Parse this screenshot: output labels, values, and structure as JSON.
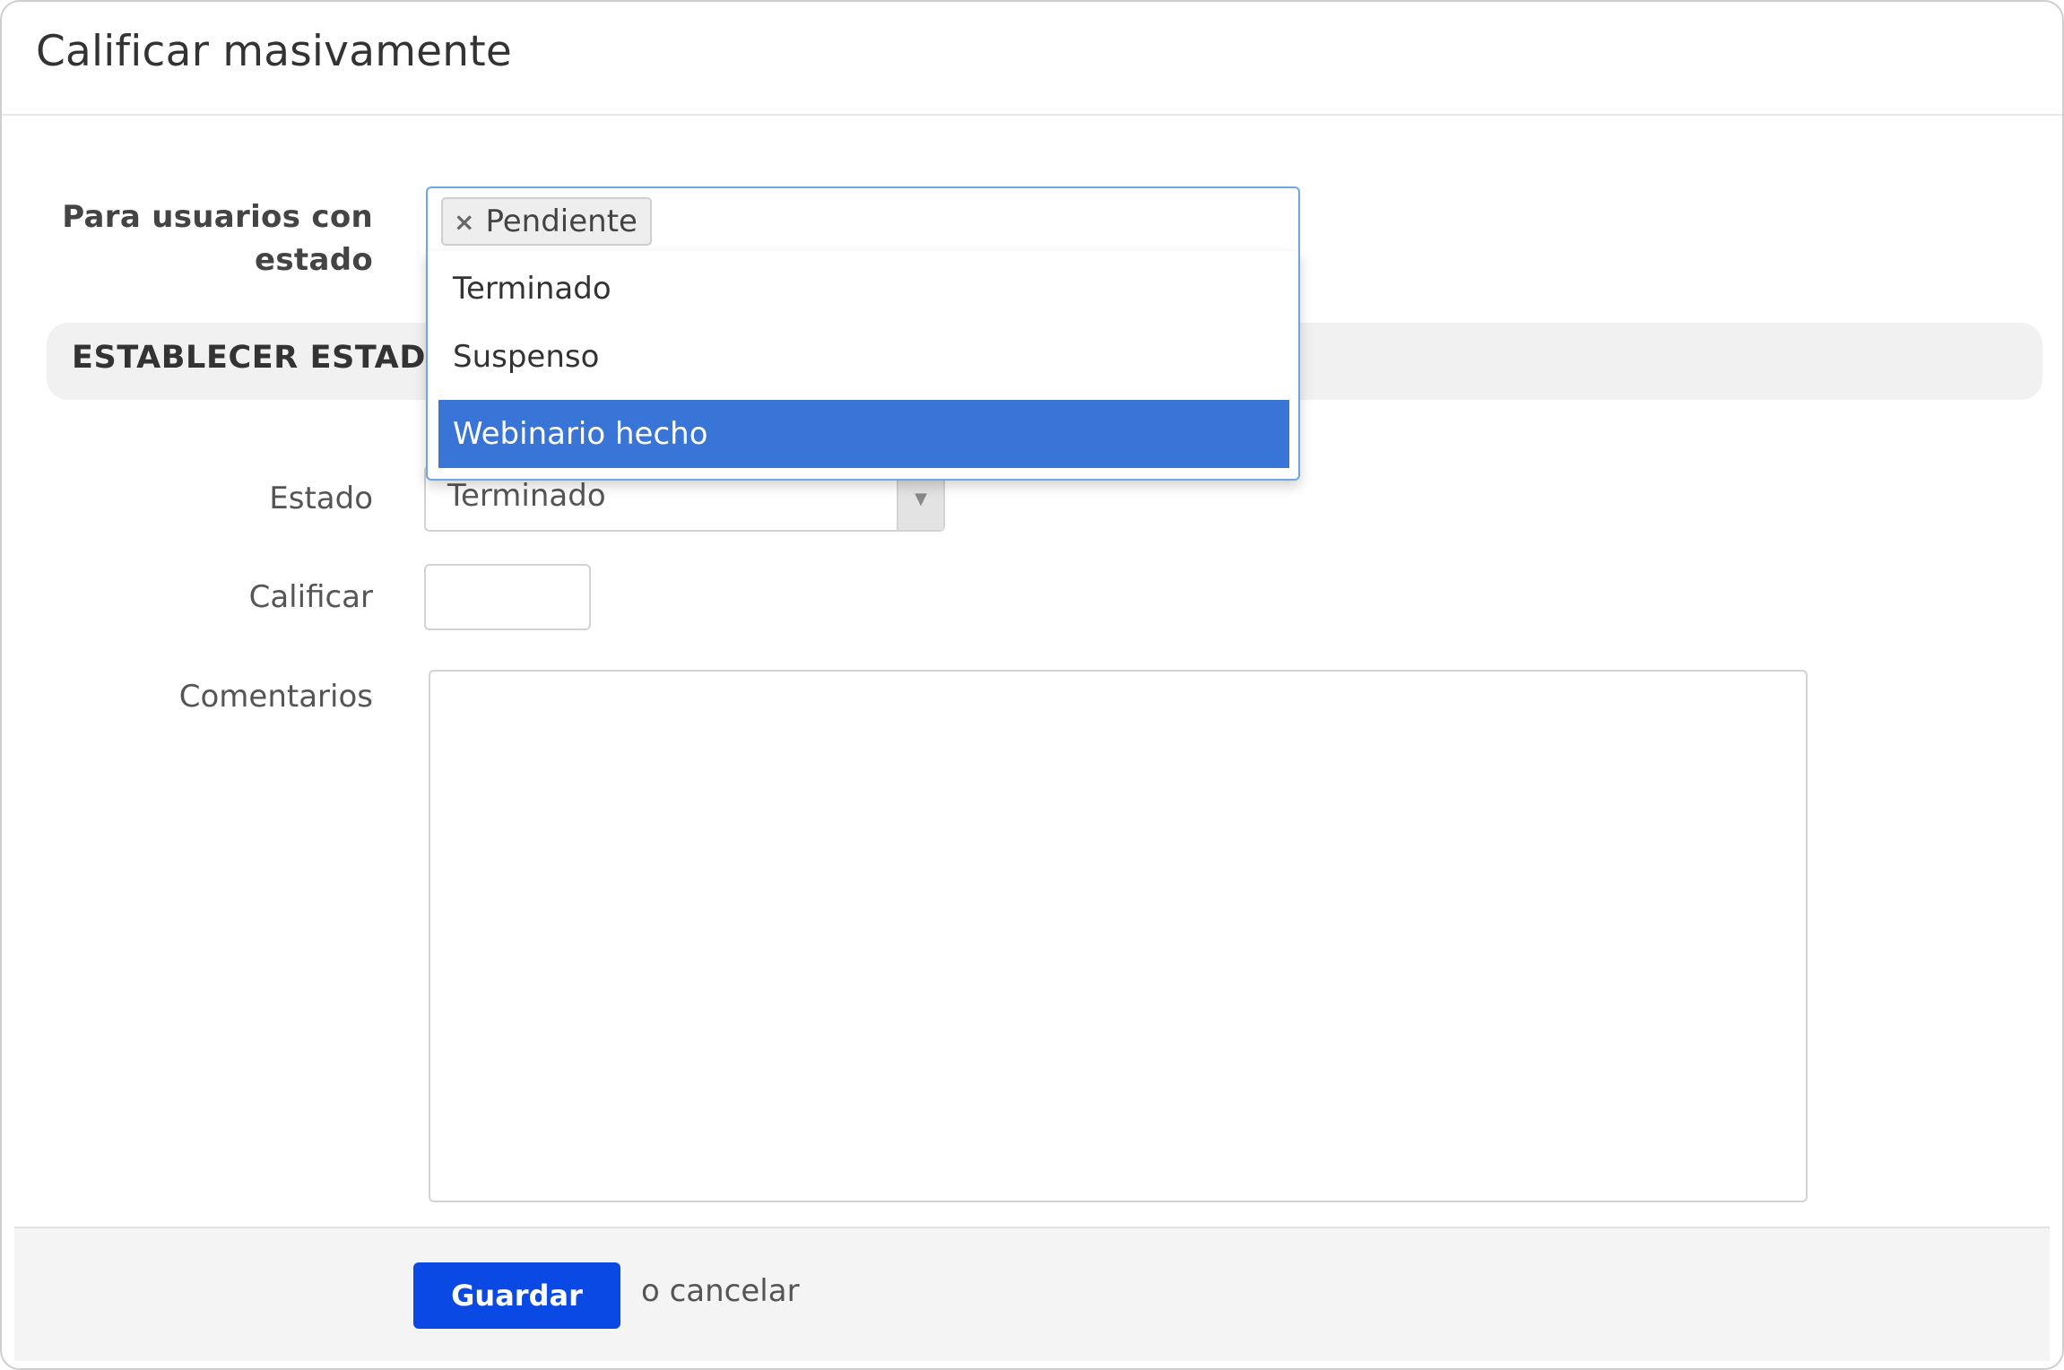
{
  "modal": {
    "title": "Calificar masivamente"
  },
  "filter": {
    "label_line1": "Para usuarios con",
    "label_line2": "estado",
    "selected_tags": [
      "Pendiente"
    ],
    "tag_remove_glyph": "×",
    "options": [
      {
        "label": "Terminado",
        "highlighted": false
      },
      {
        "label": "Suspenso",
        "highlighted": false
      },
      {
        "label": "Webinario hecho",
        "highlighted": true
      }
    ]
  },
  "section": {
    "title": "ESTABLECER ESTADO"
  },
  "status": {
    "label": "Estado",
    "value": "Terminado",
    "arrow_icon": "caret-down-icon"
  },
  "grade": {
    "label": "Calificar",
    "value": ""
  },
  "comments": {
    "label": "Comentarios",
    "value": ""
  },
  "footer": {
    "save_label": "Guardar",
    "cancel_label": "o cancelar"
  },
  "colors": {
    "primary_button": "#0a49e3",
    "highlight": "#3875d7",
    "focus_border": "#6fa4e6"
  }
}
